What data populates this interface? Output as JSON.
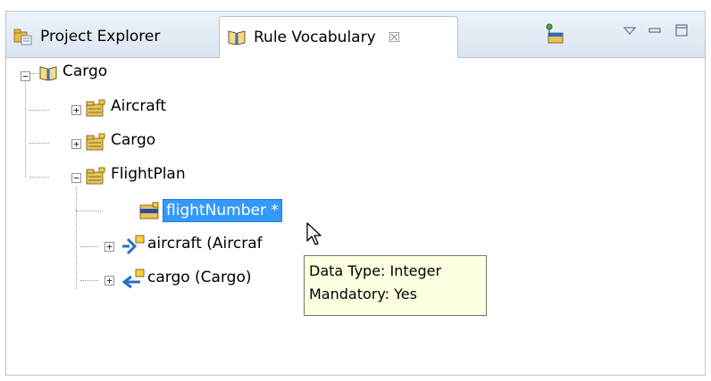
{
  "tabs": [
    {
      "label": "Project Explorer",
      "icon": "project-explorer-icon",
      "active": false
    },
    {
      "label": "Rule Vocabulary",
      "icon": "book-icon",
      "active": true,
      "close_glyph": "☒"
    }
  ],
  "toolbar": {
    "actions": [
      "new-item-icon",
      "view-menu-icon",
      "minimize-icon",
      "maximize-icon"
    ]
  },
  "tree": {
    "root": {
      "label": "Cargo",
      "icon": "book-icon",
      "expanded": true
    },
    "entities": [
      {
        "label": "Aircraft",
        "icon": "entity-folder-icon",
        "expanded": false
      },
      {
        "label": "Cargo",
        "icon": "entity-folder-icon",
        "expanded": false
      },
      {
        "label": "FlightPlan",
        "icon": "entity-folder-icon",
        "expanded": true
      }
    ],
    "flightplan_children": [
      {
        "label": "flightNumber *",
        "icon": "attribute-icon",
        "selected": true
      },
      {
        "label": "aircraft (Aircraf",
        "icon": "association-icon",
        "expanded": false
      },
      {
        "label": "cargo (Cargo)",
        "icon": "association-reverse-icon",
        "expanded": false
      }
    ]
  },
  "tooltip": {
    "line1": "Data Type: Integer",
    "line2": "Mandatory: Yes"
  },
  "colors": {
    "selection": "#3399ff",
    "tooltip_bg": "#ffffe1",
    "tab_border": "#b8c4d6"
  }
}
